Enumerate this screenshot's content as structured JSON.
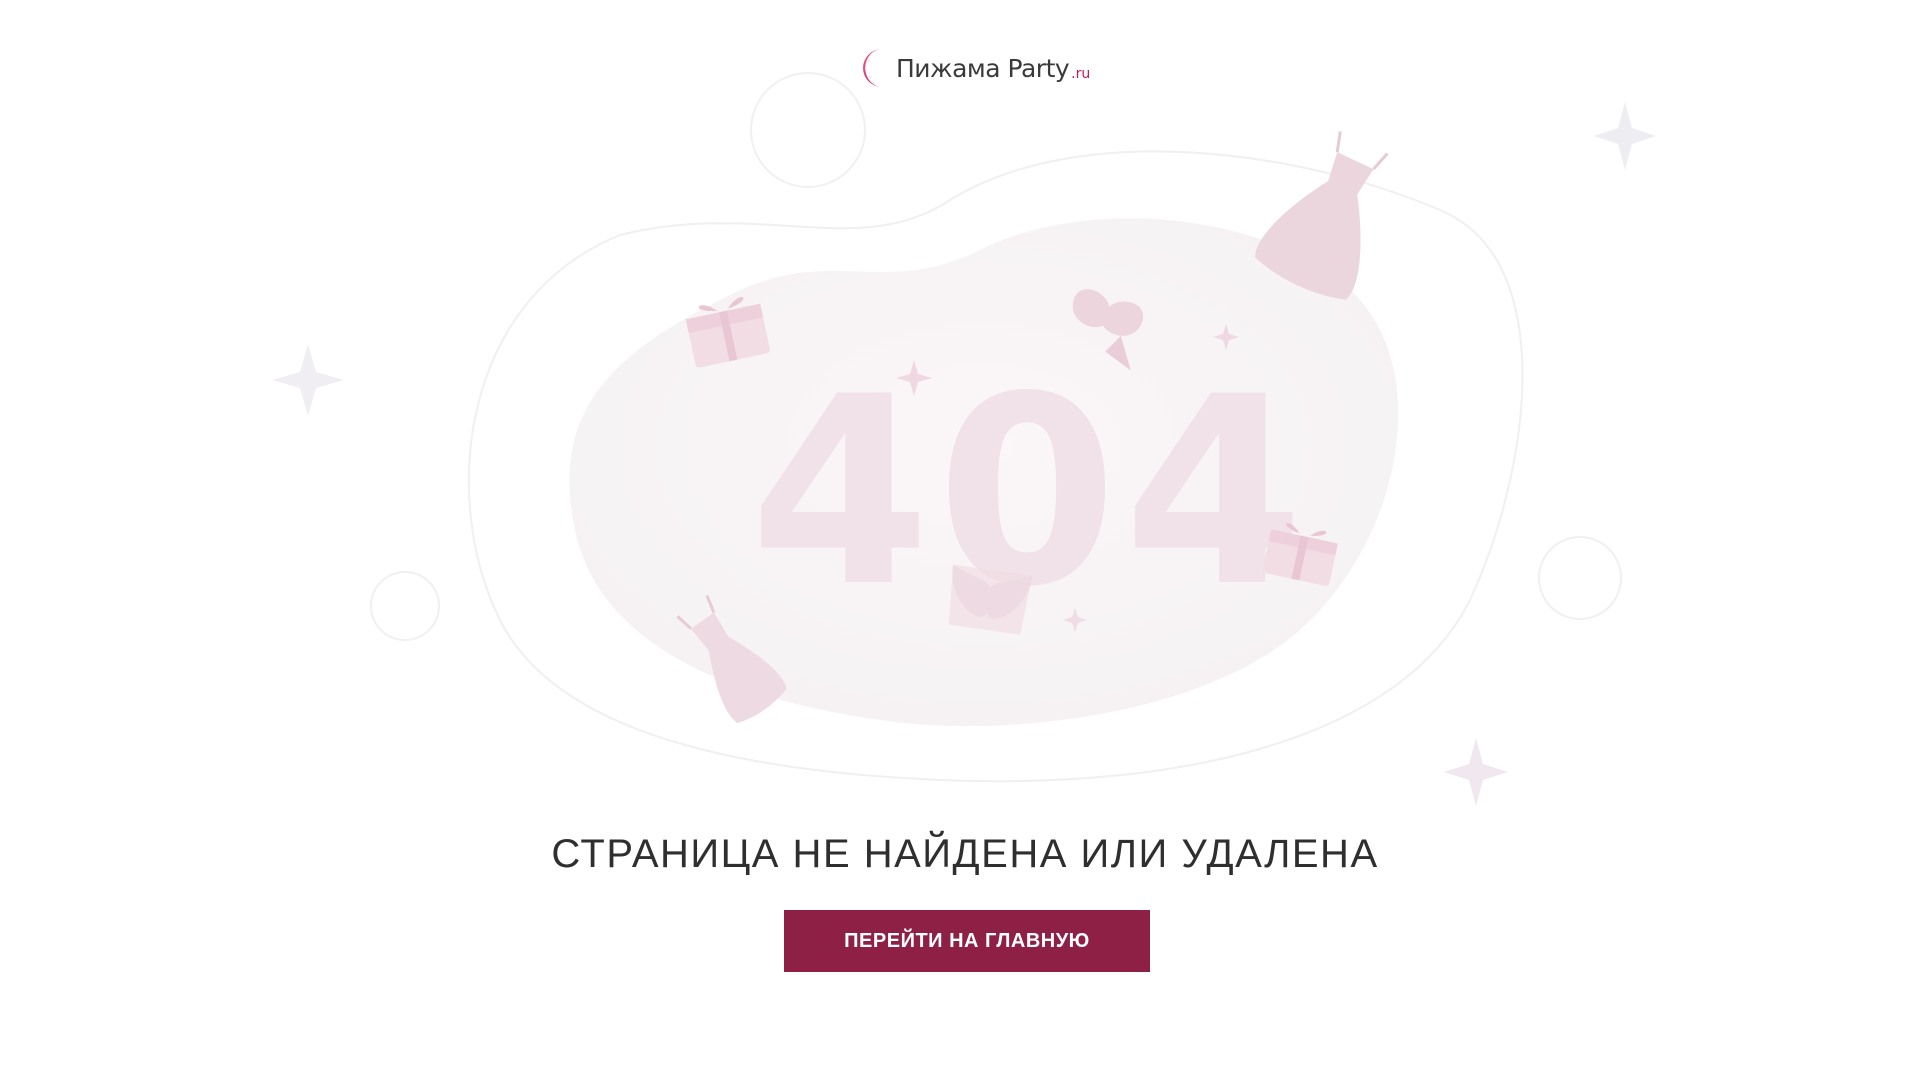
{
  "logo": {
    "brand": "Пижама Party",
    "suffix": ".ru"
  },
  "illustration": {
    "code": "404"
  },
  "message": {
    "heading": "СТРАНИЦА НЕ НАЙДЕНА ИЛИ УДАЛЕНА"
  },
  "actions": {
    "home_label": "ПЕРЕЙТИ НА ГЛАВНУЮ"
  },
  "colors": {
    "accent": "#8e1f45",
    "logo_pink": "#c2185b",
    "illustration_tint": "#f3e4ea"
  },
  "icons": [
    "moon-logo-icon",
    "sparkle-icon",
    "gift-box-icon",
    "slip-dress-icon",
    "dress-icon",
    "bra-icon",
    "sleep-mask-icon"
  ]
}
